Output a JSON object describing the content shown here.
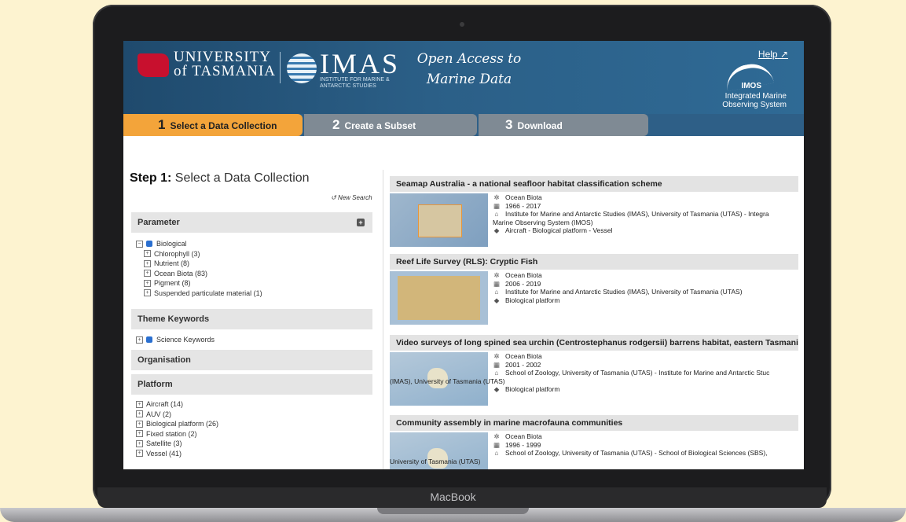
{
  "header": {
    "utas": "UNIVERSITY of TASMANIA",
    "imas": "IMAS",
    "imas_sub": "INSTITUTE FOR MARINE & ANTARCTIC STUDIES",
    "tagline": "Open Access to Marine Data",
    "help": "Help",
    "imos_name": "IMOS",
    "imos_full": "Integrated Marine Observing System"
  },
  "steps": [
    {
      "num": "1",
      "label": "Select a Data Collection"
    },
    {
      "num": "2",
      "label": "Create a Subset"
    },
    {
      "num": "3",
      "label": "Download"
    }
  ],
  "left": {
    "step_prefix": "Step 1:",
    "step_title": "Select a Data Collection",
    "new_search": "New Search",
    "parameter_head": "Parameter",
    "parameter_root": "Biological",
    "parameter_items": [
      "Chlorophyll (3)",
      "Nutrient (8)",
      "Ocean Biota (83)",
      "Pigment (8)",
      "Suspended particulate material (1)"
    ],
    "theme_head": "Theme Keywords",
    "theme_item": "Science Keywords",
    "org_head": "Organisation",
    "platform_head": "Platform",
    "platform_items": [
      "Aircraft (14)",
      "AUV (2)",
      "Biological platform (26)",
      "Fixed station (2)",
      "Satellite (3)",
      "Vessel (41)"
    ]
  },
  "results": [
    {
      "title": "Seamap Australia - a national seafloor habitat classification scheme",
      "param": "Ocean Biota",
      "dates": "1966 - 2017",
      "org": "Institute for Marine and Antarctic Studies (IMAS), University of Tasmania (UTAS) - Integra",
      "org_cont": "Marine Observing System (IMOS)",
      "platform": "Aircraft - Biological platform - Vessel"
    },
    {
      "title": "Reef Life Survey (RLS): Cryptic Fish",
      "param": "Ocean Biota",
      "dates": "2006 - 2019",
      "org": "Institute for Marine and Antarctic Studies (IMAS), University of Tasmania (UTAS)",
      "org_cont": "",
      "platform": "Biological platform"
    },
    {
      "title": "Video surveys of long spined sea urchin (Centrostephanus rodgersii) barrens habitat, eastern Tasmani",
      "param": "Ocean Biota",
      "dates": "2001 - 2002",
      "org": "School of Zoology, University of Tasmania (UTAS) - Institute for Marine and Antarctic Stuc",
      "org_cont": "(IMAS), University of Tasmania (UTAS)",
      "platform": "Biological platform"
    },
    {
      "title": "Community assembly in marine macrofauna communities",
      "param": "Ocean Biota",
      "dates": "1996 - 1999",
      "org": "School of Zoology, University of Tasmania (UTAS) - School of Biological Sciences (SBS),",
      "org_cont": "University of Tasmania (UTAS)",
      "platform": ""
    }
  ],
  "device_label": "MacBook"
}
